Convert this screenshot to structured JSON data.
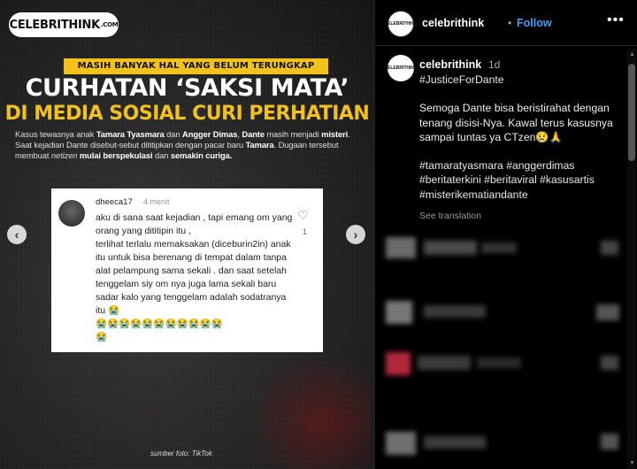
{
  "post": {
    "logo": "CELEBRITHINK",
    "logo_suffix": ".COM",
    "kicker": "MASIH BANYAK HAL YANG BELUM TERUNGKAP",
    "headline_line1": "CURHATAN ‘SAKSI MATA’",
    "headline_line2": "DI MEDIA SOSIAL CURI PERHATIAN",
    "summary": [
      {
        "t": "Kasus tewasnya anak ",
        "b": false
      },
      {
        "t": "Tamara Tyasmara",
        "b": true
      },
      {
        "t": " dan ",
        "b": false
      },
      {
        "t": "Angger Dimas",
        "b": true
      },
      {
        "t": ", ",
        "b": false
      },
      {
        "t": "Dante",
        "b": true
      },
      {
        "t": " masih menjadi ",
        "b": false
      },
      {
        "t": "misteri",
        "b": true
      },
      {
        "t": ". Saat kejadian Dante disebut-sebut dititipkan dengan pacar baru ",
        "b": false
      },
      {
        "t": "Tamara",
        "b": true
      },
      {
        "t": ". Dugaan tersebut membuat ",
        "b": false
      },
      {
        "t": "netizen",
        "b": false,
        "i": true
      },
      {
        "t": " mulai berspekulasi",
        "b": true
      },
      {
        "t": " dan ",
        "b": false
      },
      {
        "t": "semakin curiga.",
        "b": true
      }
    ],
    "comment": {
      "username": "dheeca17",
      "time": "4 menit",
      "text": "aku di sana saat kejadian , tapi emang om yang orang yang dititipin itu ,\nterlihat terlalu memaksakan (diceburin2in) anak itu untuk bisa berenang di tempat dalam tanpa alat pelampung sama sekali . dan saat setelah tenggelam siy om nya juga lama sekali baru sadar kalo yang tenggelam adalah sodatranya itu 😭\n😭😭😭😭😭😭😭😭😭😭😭\n😭",
      "likes": "1"
    },
    "source": "sumber foto: TikTok"
  },
  "panel": {
    "account": "celebrithink",
    "dot": "•",
    "follow": "Follow",
    "more": "•••",
    "caption": {
      "username": "celebrithink",
      "time": "1d",
      "hashtag_top": "#JusticeForDante",
      "body": "Semoga Dante bisa beristirahat dengan tenang disisi-Nya. Kawal terus kasusnya sampai tuntas ya CTzen😢🙏",
      "tags_line1": "#tamaratyasmara #anggerdimas",
      "tags_line2": "#beritaterkini #beritaviral #kasusartis",
      "tags_line3": "#misterikematiandante",
      "see_translation": "See translation"
    }
  },
  "icons": {
    "prev": "chevron-left-icon",
    "next": "chevron-right-icon",
    "heart": "heart-icon"
  }
}
